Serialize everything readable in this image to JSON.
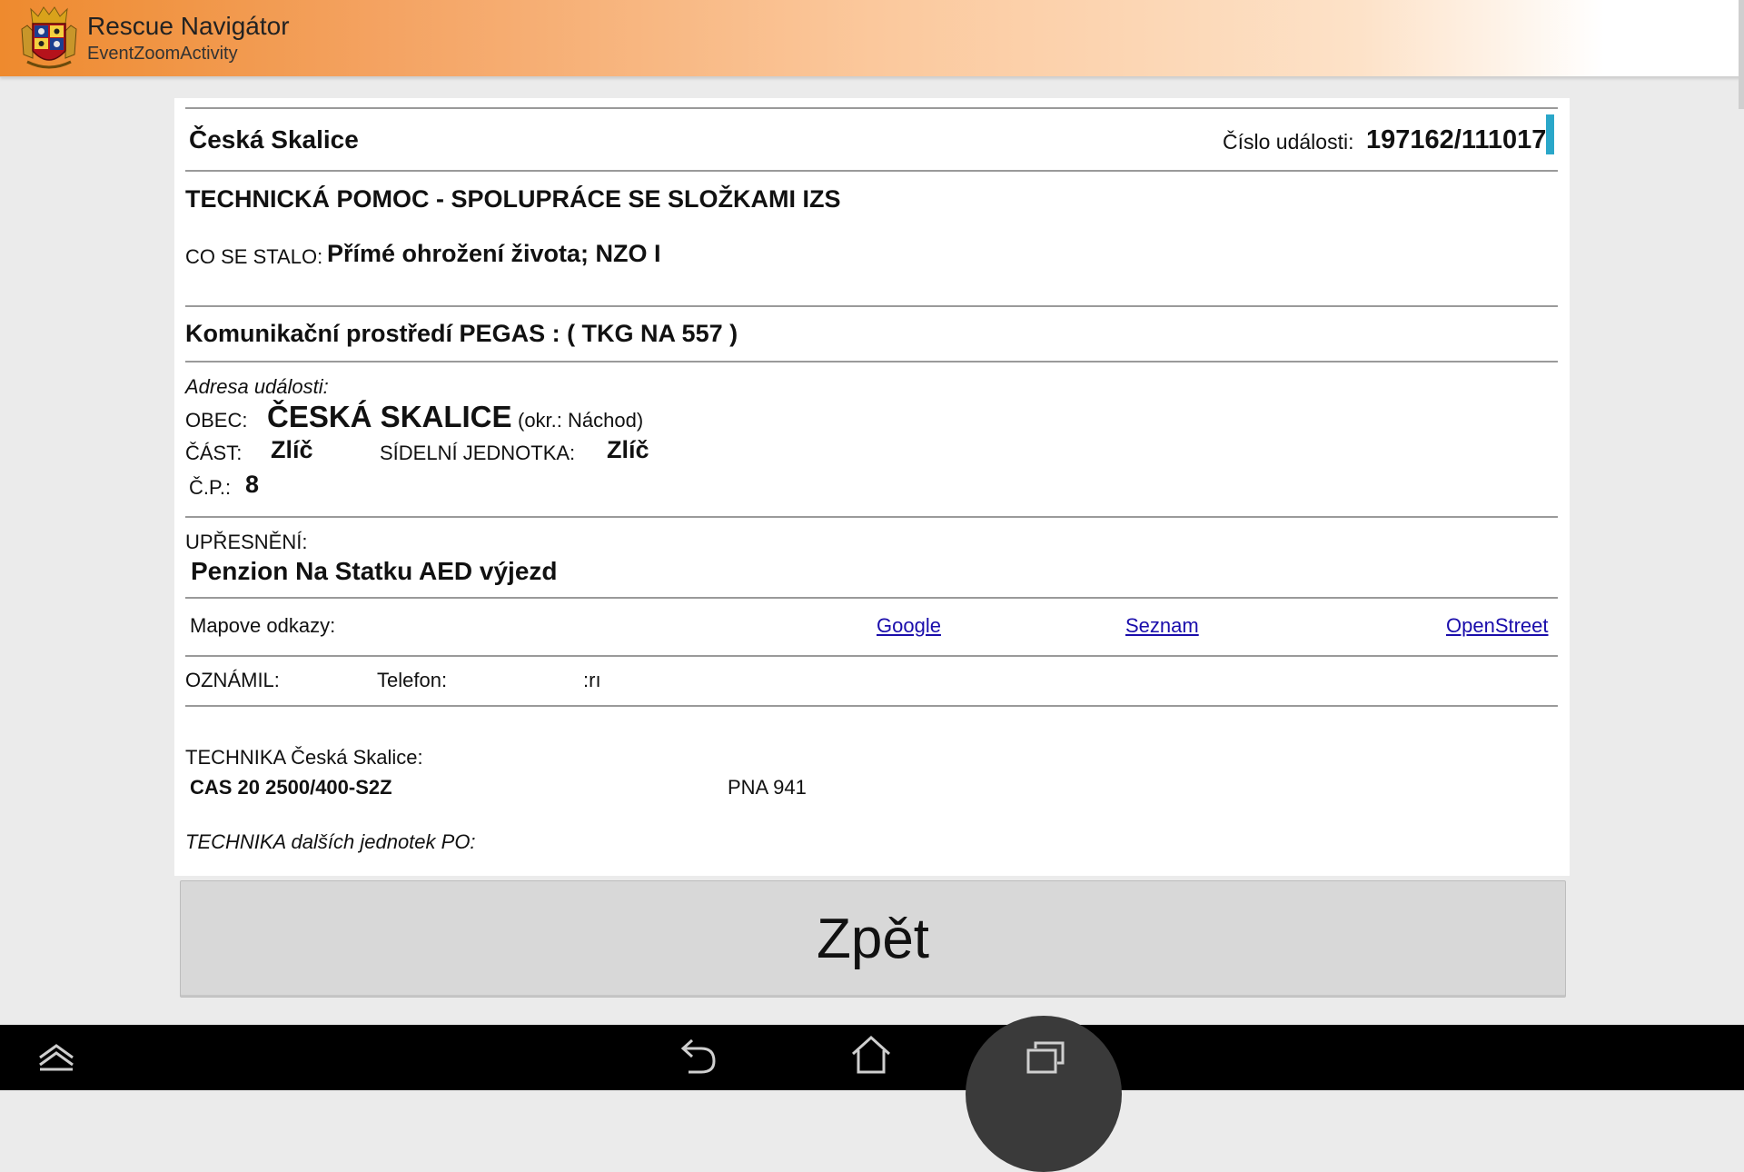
{
  "app": {
    "title": "Rescue Navigátor",
    "subtitle": "EventZoomActivity",
    "logo_icon": "coat-of-arms-logo"
  },
  "event": {
    "unit": "Česká Skalice",
    "number_label": "Číslo události:",
    "number_value": "197162/111017",
    "type": "TECHNICKÁ POMOC - SPOLUPRÁCE SE SLOŽKAMI IZS",
    "what_label": "CO SE STALO:",
    "what_value": "Přímé ohrožení života; NZO I",
    "comm": "Komunikační prostředí PEGAS : ( TKG NA 557 )"
  },
  "address": {
    "heading": "Adresa události:",
    "obec_label": "OBEC:",
    "obec_value": "ČESKÁ SKALICE",
    "okres": "(okr.: Náchod)",
    "cast_label": "ČÁST:",
    "cast_value": "Zlíč",
    "sidelni_label": "SÍDELNÍ JEDNOTKA:",
    "sidelni_value": "Zlíč",
    "cp_label": "Č.P.:",
    "cp_value": "8"
  },
  "detail": {
    "label": "UPŘESNĚNÍ:",
    "value": "Penzion Na Statku AED výjezd"
  },
  "maps": {
    "label": "Mapove odkazy:",
    "links": [
      "Google",
      "Seznam",
      "OpenStreet"
    ]
  },
  "reporter": {
    "label": "OZNÁMIL:",
    "phone_label": "Telefon:",
    "phone_fragment": ":rı"
  },
  "technika": {
    "label": "TECHNIKA Česká Skalice:",
    "vehicle": "CAS 20 2500/400-S2Z",
    "vehicle_code": "PNA 941",
    "other_label": "TECHNIKA dalších jednotek PO:"
  },
  "back_button": {
    "label": "Zpět"
  },
  "colors": {
    "appbar_start": "#ee8a2e",
    "link": "#1a0dab",
    "cursor": "#2aa7c9",
    "button_bg": "#d8d8d8"
  },
  "navigation": {
    "icons": [
      "collapse-icon",
      "back-icon",
      "home-icon",
      "recent-apps-icon"
    ]
  }
}
